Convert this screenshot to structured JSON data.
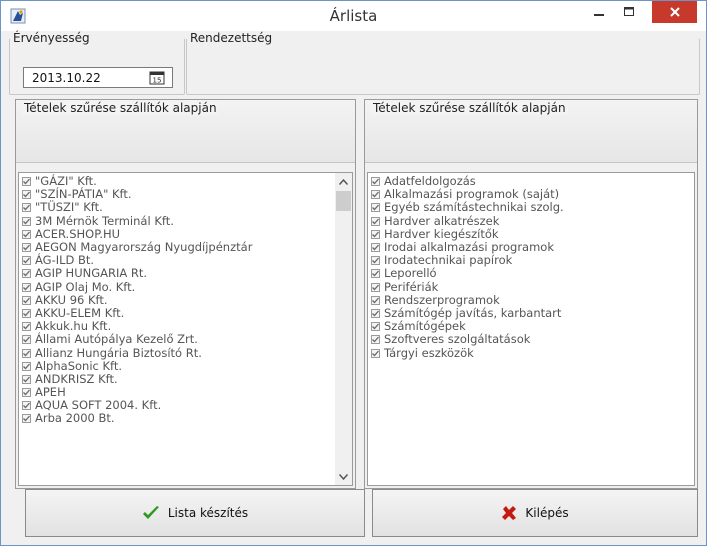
{
  "window": {
    "title": "Árlista",
    "close_color": "#c7392b"
  },
  "validity": {
    "legend": "Érvényesség",
    "date": "2013.10.22",
    "calendar_icon": "calendar-icon"
  },
  "order": {
    "legend": "Rendezettség"
  },
  "suppliers_panel": {
    "header": "Tételek szűrése szállítók alapján",
    "items": [
      "\"GÁZI\" Kft.",
      "\"SZÍN-PÁTIA\" Kft.",
      "\"TÜSZI\" Kft.",
      "3M Mérnök Terminál Kft.",
      "ACER.SHOP.HU",
      "AEGON Magyarország Nyugdíjpénztár",
      "ÁG-ILD Bt.",
      "AGIP HUNGARIA Rt.",
      "AGIP Olaj Mo. Kft.",
      "AKKU 96 Kft.",
      "AKKU-ELEM Kft.",
      "Akkuk.hu Kft.",
      "Állami Autópálya Kezelő Zrt.",
      "Allianz Hungária Biztosító Rt.",
      "AlphaSonic Kft.",
      "ANDKRISZ Kft.",
      "APEH",
      "AQUA SOFT 2004. Kft.",
      "Arba 2000 Bt."
    ]
  },
  "categories_panel": {
    "header": "Tételek szűrése szállítók alapján",
    "items": [
      "Adatfeldolgozás",
      "Alkalmazási programok (saját)",
      "Egyéb számítástechnikai szolg.",
      "Hardver alkatrészek",
      "Hardver kiegészítők",
      "Irodai alkalmazási programok",
      "Irodatechnikai papírok",
      "Leporelló",
      "Perifériák",
      "Rendszerprogramok",
      "Számítógép javítás, karbantart",
      "Számítógépek",
      "Szoftveres szolgáltatások",
      "Tárgyi eszközök"
    ]
  },
  "buttons": {
    "make_list": "Lista készítés",
    "exit": "Kilépés",
    "make_list_icon": "checkmark-icon",
    "exit_icon": "x-icon",
    "check_color": "#2e9a1f",
    "x_color": "#c41a12"
  }
}
